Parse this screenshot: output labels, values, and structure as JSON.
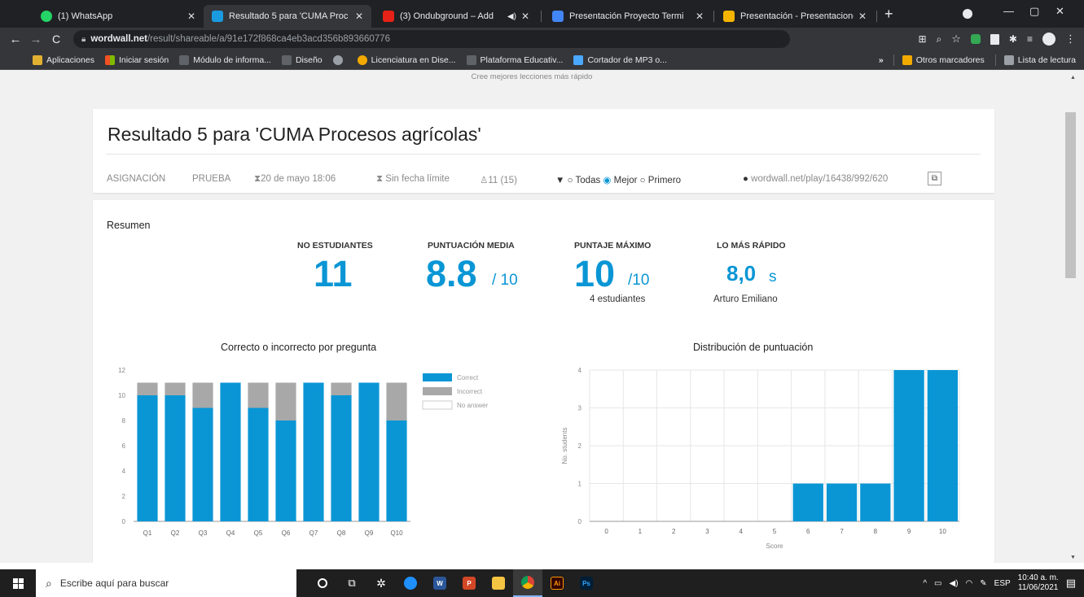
{
  "browser": {
    "tabs": [
      {
        "title": "(1) WhatsApp",
        "color": "#25d366"
      },
      {
        "title": "Resultado 5 para 'CUMA Proc",
        "color": "#1a9be0"
      },
      {
        "title": "(3) Ondubground – Add",
        "color": "#e62117"
      },
      {
        "title": "Presentación Proyecto Termi",
        "color": "#4285f4"
      },
      {
        "title": "Presentación - Presentacione",
        "color": "#f4b400"
      }
    ],
    "url_domain": "wordwall.net",
    "url_path": "/result/shareable/a/91e172f868ca4eb3acd356b893660776",
    "bookmarks": [
      {
        "label": "Aplicaciones",
        "color": "#e0b030"
      },
      {
        "label": "Iniciar sesión",
        "color": "#f25022"
      },
      {
        "label": "Módulo de informa...",
        "color": "#5f6368"
      },
      {
        "label": "Diseño",
        "color": "#5f6368"
      },
      {
        "label": "",
        "color": "#5f6368"
      },
      {
        "label": "Licenciatura en Dise...",
        "color": "#f2a900"
      },
      {
        "label": "Plataforma Educativ...",
        "color": "#5f6368"
      },
      {
        "label": "Cortador de MP3 o...",
        "color": "#4aa8ff"
      }
    ],
    "more_bookmarks": "Otros marcadores",
    "reading_list": "Lista de lectura"
  },
  "banner": "Cree mejores lecciones más rápido",
  "header": {
    "title": "Resultado 5 para 'CUMA Procesos agrícolas'",
    "assignment": "ASIGNACIÓN",
    "test": "PRUEBA",
    "date": "20 de mayo 18:06",
    "deadline": "Sin fecha límite",
    "participants": "11 (15)",
    "filter_all": "Todas",
    "filter_best": "Mejor",
    "filter_first": "Primero",
    "share_link": "wordwall.net/play/16438/992/620"
  },
  "summary": {
    "label": "Resumen",
    "students_label": "NO ESTUDIANTES",
    "students_value": "11",
    "avg_label": "PUNTUACIÓN MEDIA",
    "avg_value": "8.8",
    "avg_unit": "/ 10",
    "max_label": "PUNTAJE MÁXIMO",
    "max_value": "10",
    "max_unit": "/10",
    "max_sub": "4 estudiantes",
    "fast_label": "LO MÁS RÁPIDO",
    "fast_value": "8,0",
    "fast_unit": "s",
    "fast_sub": "Arturo Emiliano"
  },
  "colors": {
    "accent": "#0a96d5",
    "bar_blue": "#0a96d5",
    "bar_gray": "#a8a8a8"
  },
  "chart_data": [
    {
      "type": "bar",
      "stacked": true,
      "title": "Correcto o incorrecto por pregunta",
      "categories": [
        "Q1",
        "Q2",
        "Q3",
        "Q4",
        "Q5",
        "Q6",
        "Q7",
        "Q8",
        "Q9",
        "Q10"
      ],
      "series": [
        {
          "name": "Correct",
          "values": [
            10,
            10,
            9,
            11,
            9,
            8,
            11,
            10,
            11,
            8
          ]
        },
        {
          "name": "Incorrect",
          "values": [
            1,
            1,
            2,
            0,
            2,
            3,
            0,
            1,
            0,
            3
          ]
        },
        {
          "name": "No answer",
          "values": [
            0,
            0,
            0,
            0,
            0,
            0,
            0,
            0,
            0,
            0
          ]
        }
      ],
      "ylim": [
        0,
        12
      ],
      "yticks": [
        0,
        2,
        4,
        6,
        8,
        10,
        12
      ],
      "legend_position": "top-right"
    },
    {
      "type": "bar",
      "title": "Distribución de puntuación",
      "categories": [
        "0",
        "1",
        "2",
        "3",
        "4",
        "5",
        "6",
        "7",
        "8",
        "9",
        "10"
      ],
      "values": [
        0,
        0,
        0,
        0,
        0,
        0,
        1,
        1,
        1,
        4,
        4
      ],
      "xlabel": "Score",
      "ylabel": "No. students",
      "ylim": [
        0,
        4
      ],
      "yticks": [
        0,
        1,
        2,
        3,
        4
      ],
      "grid": true
    }
  ],
  "taskbar": {
    "search_placeholder": "Escribe aquí para buscar",
    "language": "ESP",
    "time": "10:40 a. m.",
    "date": "11/06/2021"
  }
}
